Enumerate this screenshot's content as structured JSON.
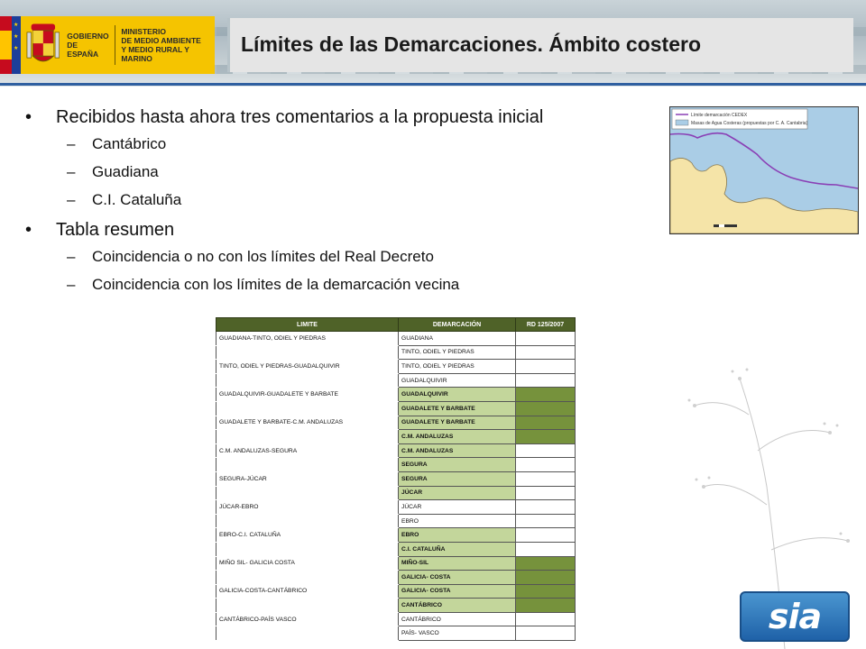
{
  "header": {
    "gov_lines": [
      "GOBIERNO",
      "DE ESPAÑA"
    ],
    "ministry_lines": [
      "MINISTERIO",
      "DE MEDIO AMBIENTE",
      "Y MEDIO RURAL Y MARINO"
    ],
    "title": "Límites de las Demarcaciones. Ámbito costero"
  },
  "bullets": {
    "b1": "Recibidos hasta ahora tres comentarios a la propuesta inicial",
    "b1_items": [
      "Cantábrico",
      "Guadiana",
      "C.I. Cataluña"
    ],
    "b2": "Tabla resumen",
    "b2_items": [
      "Coincidencia o no con los límites del Real Decreto",
      "Coincidencia con los límites de la demarcación vecina"
    ]
  },
  "map": {
    "legend": [
      "Límite demarcación CEDEX",
      "Masas de Agua Costeras (propuestas por C. A. Cantabria)"
    ],
    "colors": {
      "sea": "#aacde6",
      "land": "#f5e4a8",
      "boundary": "#8a3fb5"
    }
  },
  "table": {
    "headers": [
      "LIMITE",
      "DEMARCACIÓN",
      "RD 125/2007"
    ],
    "colors": {
      "header": "#4f6228",
      "light": "#c3d69b",
      "dark": "#76923c"
    },
    "rows": [
      {
        "limite": "GUADIANA-TINTO, ODIEL Y PIEDRAS",
        "dem": "GUADIANA",
        "dem_fill": "none",
        "rd_fill": "none"
      },
      {
        "limite": "",
        "dem": "TINTO, ODIEL Y PIEDRAS",
        "dem_fill": "none",
        "rd_fill": "none"
      },
      {
        "limite": "TINTO, ODIEL Y PIEDRAS-GUADALQUIVIR",
        "dem": "TINTO, ODIEL Y PIEDRAS",
        "dem_fill": "none",
        "rd_fill": "none"
      },
      {
        "limite": "",
        "dem": "GUADALQUIVIR",
        "dem_fill": "none",
        "rd_fill": "none"
      },
      {
        "limite": "GUADALQUIVIR-GUADALETE Y BARBATE",
        "dem": "GUADALQUIVIR",
        "dem_fill": "light",
        "rd_fill": "dark"
      },
      {
        "limite": "",
        "dem": "GUADALETE Y BARBATE",
        "dem_fill": "light",
        "rd_fill": "dark"
      },
      {
        "limite": "GUADALETE Y BARBATE-C.M. ANDALUZAS",
        "dem": "GUADALETE Y BARBATE",
        "dem_fill": "light",
        "rd_fill": "dark"
      },
      {
        "limite": "",
        "dem": "C.M. ANDALUZAS",
        "dem_fill": "light",
        "rd_fill": "dark"
      },
      {
        "limite": "C.M. ANDALUZAS-SEGURA",
        "dem": "C.M. ANDALUZAS",
        "dem_fill": "light",
        "rd_fill": "none"
      },
      {
        "limite": "",
        "dem": "SEGURA",
        "dem_fill": "light",
        "rd_fill": "none"
      },
      {
        "limite": "SEGURA-JÚCAR",
        "dem": "SEGURA",
        "dem_fill": "light",
        "rd_fill": "none"
      },
      {
        "limite": "",
        "dem": "JÚCAR",
        "dem_fill": "light",
        "rd_fill": "none"
      },
      {
        "limite": "JÚCAR-EBRO",
        "dem": "JÚCAR",
        "dem_fill": "none",
        "rd_fill": "none"
      },
      {
        "limite": "",
        "dem": "EBRO",
        "dem_fill": "none",
        "rd_fill": "none"
      },
      {
        "limite": "EBRO-C.I. CATALUÑA",
        "dem": "EBRO",
        "dem_fill": "light",
        "rd_fill": "none"
      },
      {
        "limite": "",
        "dem": "C.I. CATALUÑA",
        "dem_fill": "light",
        "rd_fill": "none"
      },
      {
        "limite": "MIÑO SIL- GALICIA COSTA",
        "dem": "MIÑO-SIL",
        "dem_fill": "light",
        "rd_fill": "dark"
      },
      {
        "limite": "",
        "dem": "GALICIA- COSTA",
        "dem_fill": "light",
        "rd_fill": "dark"
      },
      {
        "limite": "GALICIA-COSTA-CANTÁBRICO",
        "dem": "GALICIA- COSTA",
        "dem_fill": "light",
        "rd_fill": "dark"
      },
      {
        "limite": "",
        "dem": "CANTÁBRICO",
        "dem_fill": "light",
        "rd_fill": "dark"
      },
      {
        "limite": "CANTÁBRICO-PAÍS VASCO",
        "dem": "CANTÁBRICO",
        "dem_fill": "none",
        "rd_fill": "none"
      },
      {
        "limite": "",
        "dem": "PAÍS- VASCO",
        "dem_fill": "none",
        "rd_fill": "none"
      }
    ]
  },
  "logo": {
    "text": "sia"
  }
}
